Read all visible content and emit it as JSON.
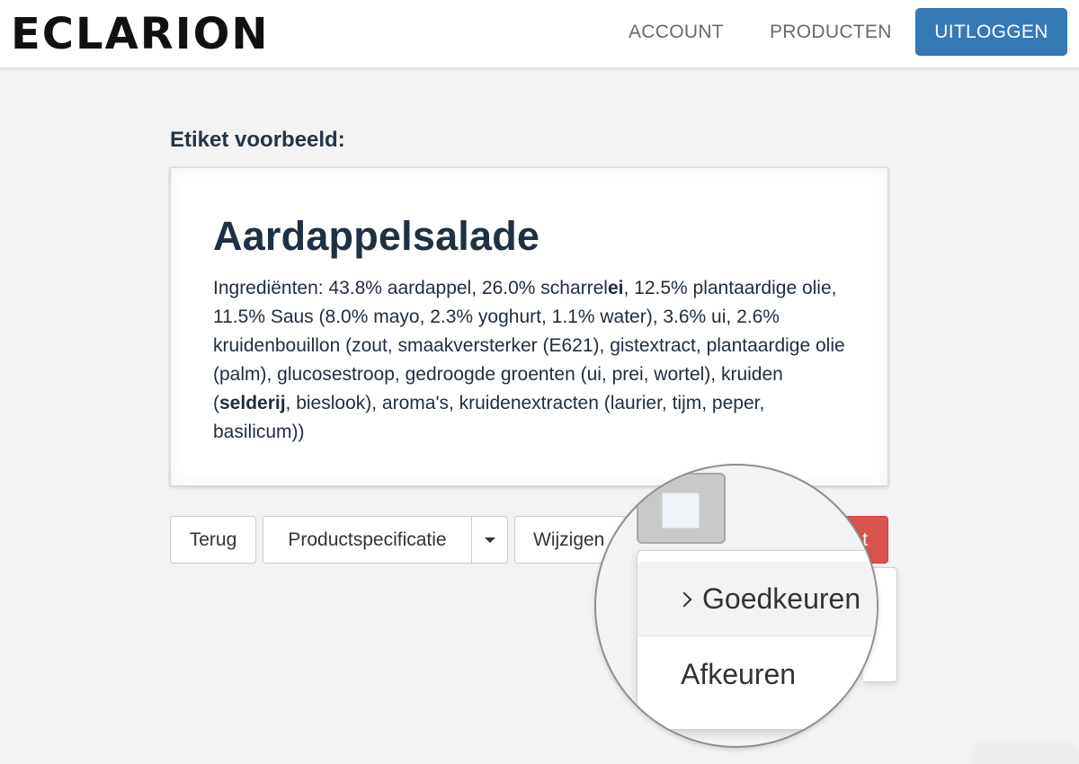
{
  "navbar": {
    "logo_text": "ECLARION",
    "links": [
      {
        "label": "ACCOUNT"
      },
      {
        "label": "PRODUCTEN"
      }
    ],
    "logout_label": "UITLOGGEN",
    "logout_color": "#337ab7"
  },
  "label_preview": {
    "heading": "Etiket voorbeeld:",
    "product_name": "Aardappelsalade",
    "ingredients": {
      "part1": "Ingrediënten: 43.8% aardappel, 26.0% scharrel",
      "bold1": "ei",
      "part2": ", 12.5% plantaardige olie, 11.5% Saus (8.0% mayo, 2.3% yoghurt, 1.1% water), 3.6% ui, 2.6% kruidenbouillon (zout, smaakversterker (E621), gistextract, plantaardige olie (palm), glucosestroop, gedroogde groenten (ui, prei, wortel), kruiden (",
      "bold2": "selderij",
      "part3": ", bieslook), aroma's, kruidenextracten (laurier, tijm, peper, basilicum))"
    }
  },
  "actions": {
    "back_label": "Terug",
    "spec_label": "Productspecificatie",
    "edit_label": "Wijzigen",
    "delete_label_visible": "t",
    "delete_color": "#d9534f"
  },
  "status_dropdown": {
    "items": [
      {
        "label": "Goedkeuren",
        "active": true
      },
      {
        "label": "Afkeuren",
        "active": false
      }
    ]
  }
}
